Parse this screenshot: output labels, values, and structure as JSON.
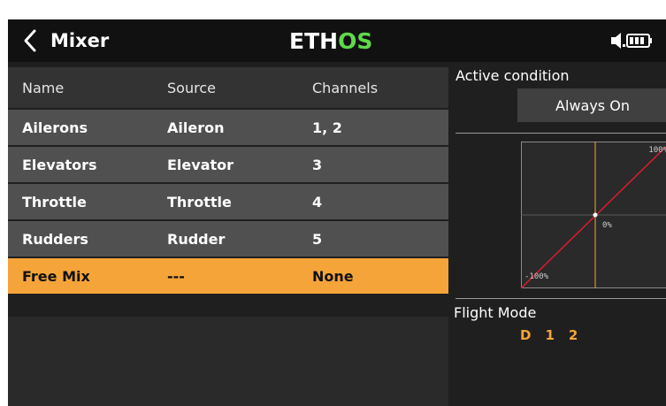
{
  "header": {
    "title": "Mixer",
    "logo_main": "ETH",
    "logo_accent": "OS",
    "back_icon": "chevron-left-icon",
    "status_icon": "volume-battery-icon"
  },
  "table": {
    "columns": [
      "Name",
      "Source",
      "Channels"
    ],
    "rows": [
      {
        "name": "Ailerons",
        "source": "Aileron",
        "channels": "1, 2"
      },
      {
        "name": "Elevators",
        "source": "Elevator",
        "channels": "3"
      },
      {
        "name": "Throttle",
        "source": "Throttle",
        "channels": "4"
      },
      {
        "name": "Rudders",
        "source": "Rudder",
        "channels": "5"
      },
      {
        "name": "Free Mix",
        "source": "---",
        "channels": "None"
      }
    ],
    "selected_row": 4
  },
  "panel": {
    "active_condition_label": "Active condition",
    "active_condition_value": "Always On",
    "curve": {
      "top_label": "100%",
      "center_label": "0%",
      "bottom_label": "-100%"
    },
    "flight_mode_label": "Flight Mode",
    "flight_modes": [
      "D",
      "1",
      "2"
    ]
  },
  "colors": {
    "accent": "#f5a43a",
    "logo_accent": "#5fd84a",
    "row_bg": "#505050",
    "curve_line": "#d81e2b"
  }
}
